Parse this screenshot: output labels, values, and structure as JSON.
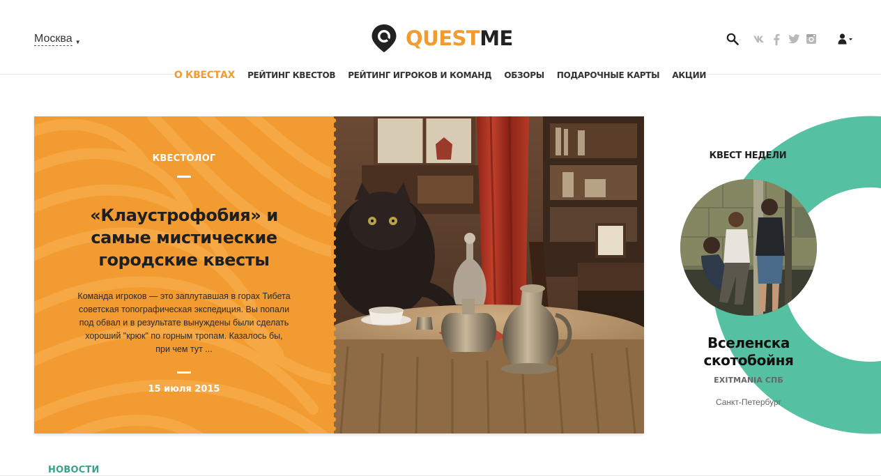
{
  "header": {
    "city": "Москва",
    "logo": {
      "part1": "QUEST",
      "part2": "ME"
    },
    "icons": [
      "search-icon",
      "vk-icon",
      "facebook-icon",
      "twitter-icon",
      "instagram-icon",
      "user-icon"
    ]
  },
  "nav": {
    "items": [
      {
        "label": "О КВЕСТАХ",
        "active": true
      },
      {
        "label": "РЕЙТИНГ КВЕСТОВ",
        "active": false
      },
      {
        "label": "РЕЙТИНГ ИГРОКОВ И КОМАНД",
        "active": false
      },
      {
        "label": "ОБЗОРЫ",
        "active": false
      },
      {
        "label": "ПОДАРОЧНЫЕ КАРТЫ",
        "active": false
      },
      {
        "label": "АКЦИИ",
        "active": false
      }
    ]
  },
  "feature": {
    "category": "КВЕСТОЛОГ",
    "title": "«Клаустрофобия» и самые мистические городские квесты",
    "excerpt": "Команда игроков — это заплутавшая в горах Тибета советская топографическая экспедиция. Вы попали под обвал и в результате вынуждены были сделать хороший \"крюк\" по горным тропам. Казалось бы, при чем тут ...",
    "date": "15 июля 2015"
  },
  "quest_of_week": {
    "heading": "КВЕСТ НЕДЕЛИ",
    "name": "Вселенска скотобойня",
    "organizer": "EXITMANIA СПБ",
    "city": "Санкт-Петербург"
  },
  "news": {
    "heading": "НОВОСТИ"
  },
  "colors": {
    "accent_orange": "#f29b30",
    "accent_green": "#56c0a2",
    "news_green": "#3aa287",
    "text_dark": "#222222"
  }
}
